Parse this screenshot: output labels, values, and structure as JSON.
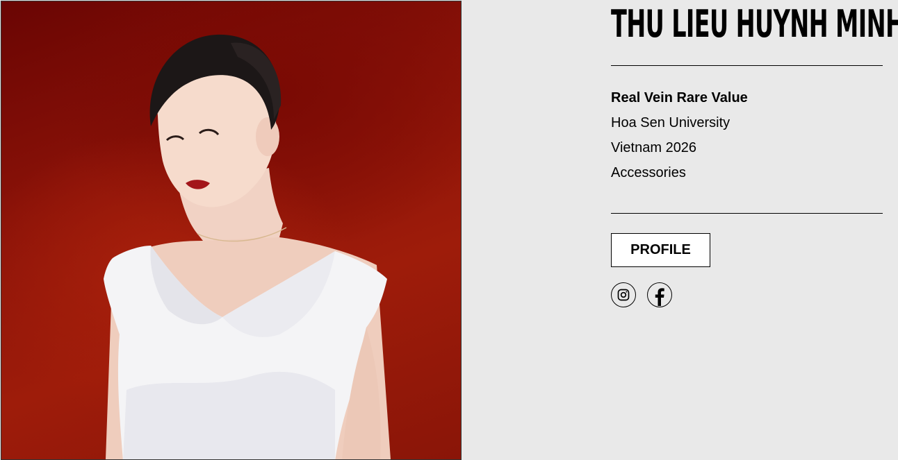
{
  "model": {
    "name": "THU LIEU HUYNH MINH",
    "title": "Real Vein Rare Value",
    "school": "Hoa Sen University",
    "event": "Vietnam 2026",
    "category": "Accessories"
  },
  "actions": {
    "profile_label": "PROFILE"
  },
  "social": [
    {
      "icon": "instagram-icon"
    },
    {
      "icon": "facebook-icon"
    }
  ],
  "colors": {
    "background": "#e9e9e9",
    "photo_backdrop": "#8a1208",
    "dress": "#f4f4f6"
  }
}
